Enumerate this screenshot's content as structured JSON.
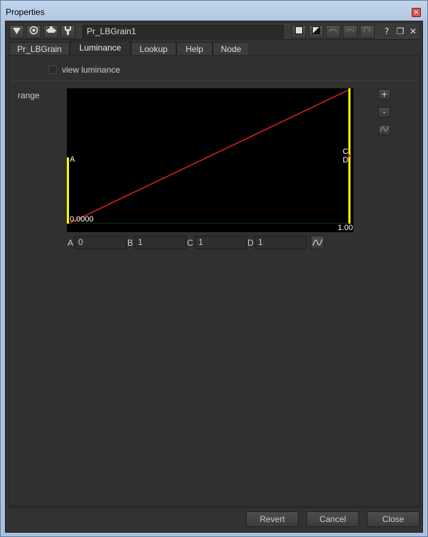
{
  "window": {
    "title": "Properties",
    "close_glyph": "×"
  },
  "toolbar": {
    "node_name": "Pr_LBGrain1",
    "icons": [
      "collapse-arrow-icon",
      "viewer-icon",
      "node-icon",
      "wrench-icon",
      "color-swatch-icon",
      "color-swatch-2-icon",
      "undo-icon",
      "redo-icon",
      "revert-icon",
      "help-icon",
      "float-icon",
      "close-icon"
    ],
    "help_glyph": "?",
    "float_glyph": "❐",
    "close_glyph": "✕"
  },
  "tabs": [
    {
      "label": "Pr_LBGrain",
      "active": false
    },
    {
      "label": "Luminance",
      "active": true
    },
    {
      "label": "Lookup",
      "active": false
    },
    {
      "label": "Help",
      "active": false
    },
    {
      "label": "Node",
      "active": false
    }
  ],
  "luminance": {
    "view_luminance_label": "view luminance",
    "view_luminance_checked": false,
    "range_label": "range",
    "curve": {
      "point_labels": {
        "a": "A",
        "c": "C",
        "d": "D"
      },
      "min_label": "0.0000",
      "max_label": "1.00"
    },
    "side_buttons": {
      "add": "+",
      "remove": "-"
    },
    "fields": [
      {
        "label": "A",
        "value": "0"
      },
      {
        "label": "B",
        "value": "1"
      },
      {
        "label": "C",
        "value": "1"
      },
      {
        "label": "D",
        "value": "1"
      }
    ]
  },
  "buttons": {
    "revert": "Revert",
    "cancel": "Cancel",
    "close": "Close"
  },
  "colors": {
    "curve_line": "#e02020",
    "handle": "#ffff00",
    "baseline": "#1f6b1f"
  }
}
